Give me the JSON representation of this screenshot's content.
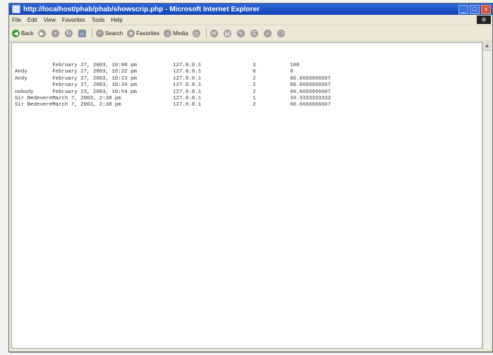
{
  "window": {
    "title": "http://localhost/phab/phab/showscrip.php - Microsoft Internet Explorer",
    "controls": [
      "_",
      "□",
      "×"
    ]
  },
  "menubar": {
    "items": [
      "File",
      "Edit",
      "View",
      "Favorites",
      "Tools",
      "Help"
    ]
  },
  "toolbar": {
    "back_label": "Back",
    "search_label": "Search",
    "favorites_label": "Favorites",
    "media_label": "Media"
  },
  "rows": [
    {
      "name": "",
      "date": "February 27, 2003, 10:00 pm",
      "ip": "127.0.0.1",
      "score": "3",
      "percent": "100"
    },
    {
      "name": "Andy",
      "date": "February 27, 2003, 10:22 pm",
      "ip": "127.0.0.1",
      "score": "0",
      "percent": "0"
    },
    {
      "name": "Andy",
      "date": "February 27, 2003, 10:23 pm",
      "ip": "127.0.0.1",
      "score": "2",
      "percent": "66.6666666667"
    },
    {
      "name": "",
      "date": "February 27, 2003, 10:34 pm",
      "ip": "127.0.0.1",
      "score": "2",
      "percent": "66.6666666667"
    },
    {
      "name": "nobody",
      "date": "February 23, 2003, 10:54 pm",
      "ip": "127.0.0.1",
      "score": "2",
      "percent": "66.6666666667"
    },
    {
      "name": "Sir Bedevere",
      "date": "March 7, 2003, 2:38 pm",
      "ip": "127.0.0.1",
      "score": "1",
      "percent": "33.3333333333"
    },
    {
      "name": "Sir Bedevere",
      "date": "March 7, 2003, 2:38 pm",
      "ip": "127.0.0.1",
      "score": "2",
      "percent": "66.6666666667"
    }
  ]
}
